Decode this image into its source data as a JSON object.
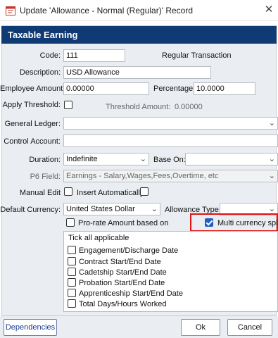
{
  "window": {
    "title": "Update 'Allowance - Normal (Regular)' Record",
    "close_glyph": "✕",
    "icon": "app-form-icon"
  },
  "section": {
    "title": "Taxable Earning"
  },
  "form": {
    "code": {
      "label": "Code:",
      "value": "111"
    },
    "transaction_type": "Regular Transaction",
    "description": {
      "label": "Description:",
      "value": "USD Allowance"
    },
    "employee_amount": {
      "label": "Employee Amount:",
      "value": "0.00000"
    },
    "percentage": {
      "label": "Percentage:",
      "value": "10.0000"
    },
    "apply_threshold": {
      "label": "Apply Threshold:",
      "checked": false
    },
    "threshold_amount": {
      "label": "Threshold Amount:",
      "value": "0.00000"
    },
    "general_ledger": {
      "label": "General Ledger:",
      "value": ""
    },
    "control_account": {
      "label": "Control Account:",
      "value": ""
    },
    "duration": {
      "label": "Duration:",
      "value": "Indefinite"
    },
    "base_on": {
      "label": "Base On:",
      "value": ""
    },
    "p6_field": {
      "label": "P6 Field:",
      "value": "Earnings - Salary,Wages,Fees,Overtime, etc"
    },
    "manual_edit": {
      "label": "Manual Edit",
      "checked": false
    },
    "insert_automatically": {
      "label": "Insert Automatically",
      "checked": false
    },
    "default_currency": {
      "label": "Default Currency:",
      "value": "United States Dollar"
    },
    "allowance_type": {
      "label": "Allowance Type:",
      "value": ""
    },
    "prorate": {
      "label": "Pro-rate Amount based on",
      "checked": false
    },
    "multi_currency": {
      "label": "Multi currency split",
      "checked": true
    },
    "tick_all_header": "Tick all applicable",
    "prorate_options": [
      {
        "label": "Engagement/Discharge Date",
        "checked": false
      },
      {
        "label": "Contract Start/End Date",
        "checked": false
      },
      {
        "label": "Cadetship Start/End Date",
        "checked": false
      },
      {
        "label": "Probation Start/End Date",
        "checked": false
      },
      {
        "label": "Apprenticeship Start/End Date",
        "checked": false
      },
      {
        "label": "Total Days/Hours Worked",
        "checked": false
      }
    ]
  },
  "footer": {
    "dependencies_label": "Dependencies",
    "ok_label": "Ok",
    "cancel_label": "Cancel"
  },
  "colors": {
    "header_bg": "#0f3a73",
    "panel_bg": "#eaeef3",
    "highlight": "#e01414",
    "checkbox_checked": "#1f5fbf"
  }
}
